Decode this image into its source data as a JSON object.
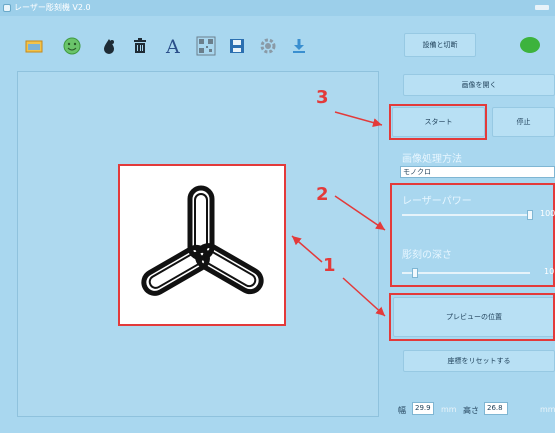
{
  "window": {
    "title": "レーザー彫刻機 V2.0"
  },
  "toolbar": {
    "icons": [
      "open-image-icon",
      "emoji-icon",
      "ink-drop-icon",
      "trash-icon",
      "text-icon",
      "qr-code-icon",
      "save-icon",
      "settings-icon",
      "download-icon"
    ],
    "connect_label": "設備と切断",
    "connection_color": "#3db33d"
  },
  "panel": {
    "open_image_label": "画像を開く",
    "start_label": "スタート",
    "stop_label": "停止",
    "processing_title": "画像処理方法",
    "processing_value": "モノクロ",
    "laser_power_title": "レーザーパワー",
    "laser_power_value": "100",
    "laser_power_level": 1.0,
    "engrave_depth_title": "彫刻の深さ",
    "engrave_depth_value": "10",
    "engrave_depth_level": 0.1,
    "preview_position_label": "プレビューの位置",
    "reset_coords_label": "座標をリセットする",
    "width_label": "幅",
    "width_value": "29.9",
    "width_unit": "mm",
    "height_label": "高さ",
    "height_value": "26.8",
    "height_unit": "mm"
  },
  "annotations": {
    "label_1": "1",
    "label_2": "2",
    "label_3": "3",
    "color": "#e33a3a"
  }
}
